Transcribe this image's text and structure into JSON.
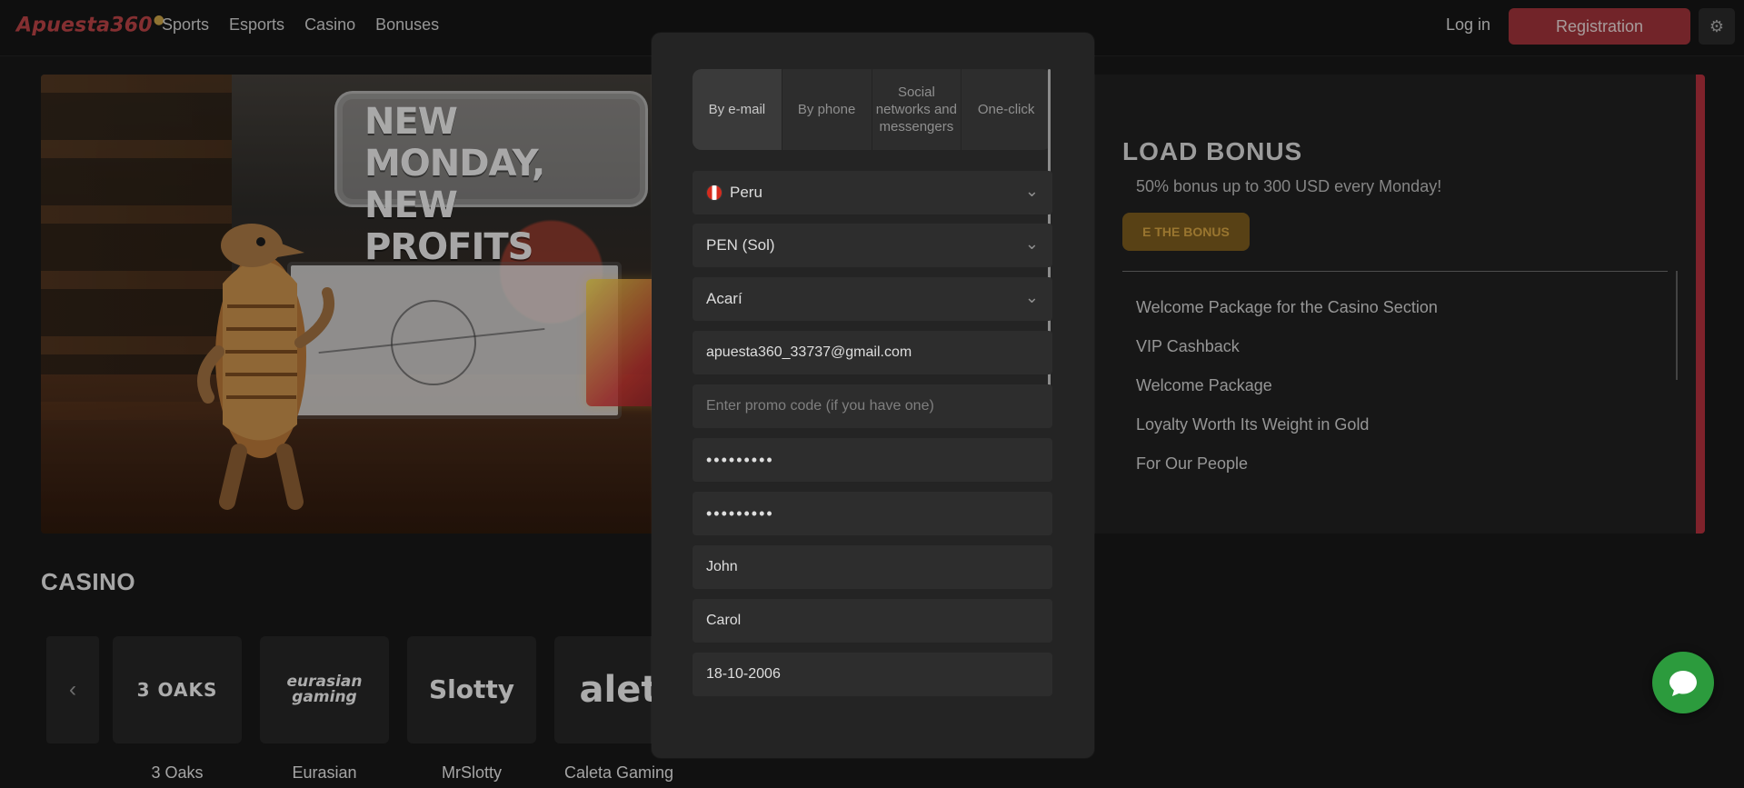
{
  "header": {
    "logo": "Apuesta360",
    "nav": [
      {
        "label": "Sports"
      },
      {
        "label": "Esports"
      },
      {
        "label": "Casino"
      },
      {
        "label": "Bonuses"
      }
    ],
    "login_label": "Log in",
    "registration_label": "Registration",
    "settings_icon": "gear-icon"
  },
  "banner": {
    "headline_line1": "NEW MONDAY,",
    "headline_line2": "NEW PROFITS",
    "bonus_title": "LOAD BONUS",
    "bonus_subtitle": "50% bonus up to 300 USD every Monday!",
    "bonus_button": "E THE BONUS",
    "bonus_list": [
      "Welcome Package for the Casino Section",
      "VIP Cashback",
      "Welcome Package",
      "Loyalty Worth Its Weight in Gold",
      "For Our People"
    ]
  },
  "casino": {
    "heading": "CASINO",
    "providers": [
      {
        "logo": "3 OAKS",
        "label": "3 Oaks"
      },
      {
        "logo": "eurasian gaming",
        "label": "Eurasian"
      },
      {
        "logo": "Slotty",
        "label": "MrSlotty"
      },
      {
        "logo": "alet",
        "label": "Caleta Gaming"
      }
    ]
  },
  "registration": {
    "tabs": [
      {
        "label": "By e-mail",
        "active": true
      },
      {
        "label": "By phone",
        "active": false
      },
      {
        "label": "Social networks and messengers",
        "active": false
      },
      {
        "label": "One-click",
        "active": false
      }
    ],
    "country": "Peru",
    "currency": "PEN (Sol)",
    "city": "Acarí",
    "email": "apuesta360_33737@gmail.com",
    "promo_placeholder": "Enter promo code (if you have one)",
    "password": "•••••••••",
    "confirm_password": "•••••••••",
    "first_name": "John",
    "last_name": "Carol",
    "birth_date": "18-10-2006"
  },
  "chat": {
    "icon": "chat-bubble-icon"
  },
  "colors": {
    "accent": "#9e3339",
    "bonus_gold": "#7b5b1e",
    "chat_green": "#2c9b3d"
  }
}
